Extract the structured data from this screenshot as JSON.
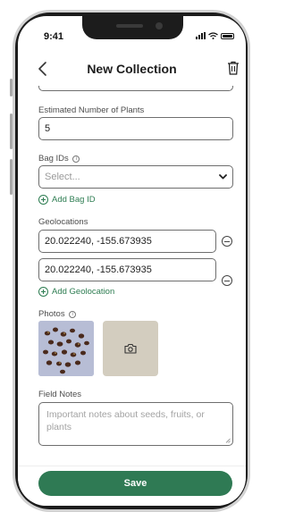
{
  "status": {
    "time": "9:41"
  },
  "header": {
    "title": "New Collection"
  },
  "form": {
    "estimated_plants": {
      "label": "Estimated Number of Plants",
      "value": "5"
    },
    "bag_ids": {
      "label": "Bag IDs",
      "placeholder": "Select...",
      "add_label": "Add Bag ID"
    },
    "geolocations": {
      "label": "Geolocations",
      "items": [
        "20.022240, -155.673935",
        "20.022240, -155.673935"
      ],
      "add_label": "Add Geolocation"
    },
    "photos": {
      "label": "Photos"
    },
    "field_notes": {
      "label": "Field Notes",
      "placeholder": "Important notes about seeds, fruits, or plants"
    }
  },
  "footer": {
    "save_label": "Save"
  },
  "colors": {
    "accent": "#2f7a54",
    "photo_tile": "#d3cdbf"
  },
  "icons": [
    "back-chevron-icon",
    "trash-icon",
    "info-icon",
    "chevron-down-icon",
    "plus-circle-icon",
    "minus-circle-icon",
    "camera-icon"
  ]
}
